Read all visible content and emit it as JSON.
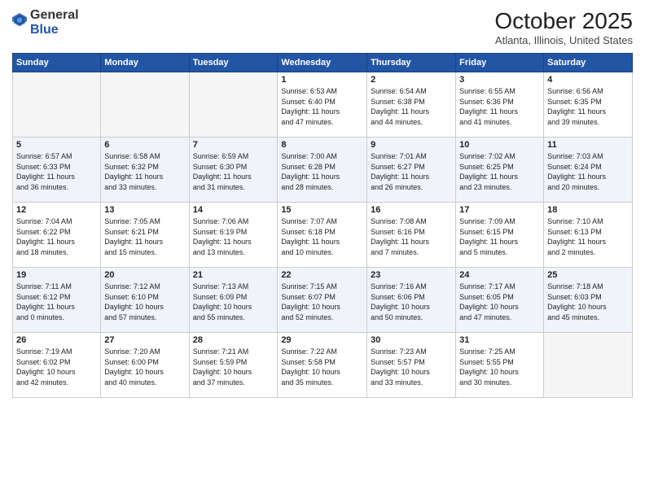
{
  "header": {
    "logo_general": "General",
    "logo_blue": "Blue",
    "month_title": "October 2025",
    "location": "Atlanta, Illinois, United States"
  },
  "weekdays": [
    "Sunday",
    "Monday",
    "Tuesday",
    "Wednesday",
    "Thursday",
    "Friday",
    "Saturday"
  ],
  "weeks": [
    [
      {
        "day": "",
        "info": ""
      },
      {
        "day": "",
        "info": ""
      },
      {
        "day": "",
        "info": ""
      },
      {
        "day": "1",
        "info": "Sunrise: 6:53 AM\nSunset: 6:40 PM\nDaylight: 11 hours\nand 47 minutes."
      },
      {
        "day": "2",
        "info": "Sunrise: 6:54 AM\nSunset: 6:38 PM\nDaylight: 11 hours\nand 44 minutes."
      },
      {
        "day": "3",
        "info": "Sunrise: 6:55 AM\nSunset: 6:36 PM\nDaylight: 11 hours\nand 41 minutes."
      },
      {
        "day": "4",
        "info": "Sunrise: 6:56 AM\nSunset: 6:35 PM\nDaylight: 11 hours\nand 39 minutes."
      }
    ],
    [
      {
        "day": "5",
        "info": "Sunrise: 6:57 AM\nSunset: 6:33 PM\nDaylight: 11 hours\nand 36 minutes."
      },
      {
        "day": "6",
        "info": "Sunrise: 6:58 AM\nSunset: 6:32 PM\nDaylight: 11 hours\nand 33 minutes."
      },
      {
        "day": "7",
        "info": "Sunrise: 6:59 AM\nSunset: 6:30 PM\nDaylight: 11 hours\nand 31 minutes."
      },
      {
        "day": "8",
        "info": "Sunrise: 7:00 AM\nSunset: 6:28 PM\nDaylight: 11 hours\nand 28 minutes."
      },
      {
        "day": "9",
        "info": "Sunrise: 7:01 AM\nSunset: 6:27 PM\nDaylight: 11 hours\nand 26 minutes."
      },
      {
        "day": "10",
        "info": "Sunrise: 7:02 AM\nSunset: 6:25 PM\nDaylight: 11 hours\nand 23 minutes."
      },
      {
        "day": "11",
        "info": "Sunrise: 7:03 AM\nSunset: 6:24 PM\nDaylight: 11 hours\nand 20 minutes."
      }
    ],
    [
      {
        "day": "12",
        "info": "Sunrise: 7:04 AM\nSunset: 6:22 PM\nDaylight: 11 hours\nand 18 minutes."
      },
      {
        "day": "13",
        "info": "Sunrise: 7:05 AM\nSunset: 6:21 PM\nDaylight: 11 hours\nand 15 minutes."
      },
      {
        "day": "14",
        "info": "Sunrise: 7:06 AM\nSunset: 6:19 PM\nDaylight: 11 hours\nand 13 minutes."
      },
      {
        "day": "15",
        "info": "Sunrise: 7:07 AM\nSunset: 6:18 PM\nDaylight: 11 hours\nand 10 minutes."
      },
      {
        "day": "16",
        "info": "Sunrise: 7:08 AM\nSunset: 6:16 PM\nDaylight: 11 hours\nand 7 minutes."
      },
      {
        "day": "17",
        "info": "Sunrise: 7:09 AM\nSunset: 6:15 PM\nDaylight: 11 hours\nand 5 minutes."
      },
      {
        "day": "18",
        "info": "Sunrise: 7:10 AM\nSunset: 6:13 PM\nDaylight: 11 hours\nand 2 minutes."
      }
    ],
    [
      {
        "day": "19",
        "info": "Sunrise: 7:11 AM\nSunset: 6:12 PM\nDaylight: 11 hours\nand 0 minutes."
      },
      {
        "day": "20",
        "info": "Sunrise: 7:12 AM\nSunset: 6:10 PM\nDaylight: 10 hours\nand 57 minutes."
      },
      {
        "day": "21",
        "info": "Sunrise: 7:13 AM\nSunset: 6:09 PM\nDaylight: 10 hours\nand 55 minutes."
      },
      {
        "day": "22",
        "info": "Sunrise: 7:15 AM\nSunset: 6:07 PM\nDaylight: 10 hours\nand 52 minutes."
      },
      {
        "day": "23",
        "info": "Sunrise: 7:16 AM\nSunset: 6:06 PM\nDaylight: 10 hours\nand 50 minutes."
      },
      {
        "day": "24",
        "info": "Sunrise: 7:17 AM\nSunset: 6:05 PM\nDaylight: 10 hours\nand 47 minutes."
      },
      {
        "day": "25",
        "info": "Sunrise: 7:18 AM\nSunset: 6:03 PM\nDaylight: 10 hours\nand 45 minutes."
      }
    ],
    [
      {
        "day": "26",
        "info": "Sunrise: 7:19 AM\nSunset: 6:02 PM\nDaylight: 10 hours\nand 42 minutes."
      },
      {
        "day": "27",
        "info": "Sunrise: 7:20 AM\nSunset: 6:00 PM\nDaylight: 10 hours\nand 40 minutes."
      },
      {
        "day": "28",
        "info": "Sunrise: 7:21 AM\nSunset: 5:59 PM\nDaylight: 10 hours\nand 37 minutes."
      },
      {
        "day": "29",
        "info": "Sunrise: 7:22 AM\nSunset: 5:58 PM\nDaylight: 10 hours\nand 35 minutes."
      },
      {
        "day": "30",
        "info": "Sunrise: 7:23 AM\nSunset: 5:57 PM\nDaylight: 10 hours\nand 33 minutes."
      },
      {
        "day": "31",
        "info": "Sunrise: 7:25 AM\nSunset: 5:55 PM\nDaylight: 10 hours\nand 30 minutes."
      },
      {
        "day": "",
        "info": ""
      }
    ]
  ]
}
